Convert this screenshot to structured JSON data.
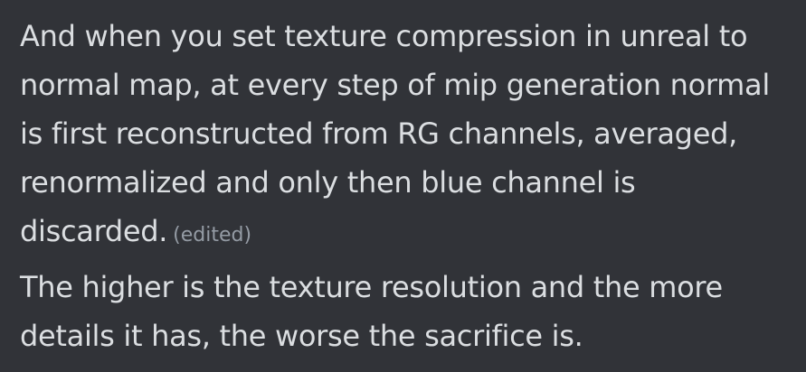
{
  "messages": [
    {
      "lines": [
        "And when you set texture compression in unreal to",
        "normal map, at every step of mip generation normal",
        "is first reconstructed from RG channels, averaged,",
        "renormalized and only then blue channel is",
        "discarded."
      ],
      "edited_label": "(edited)"
    },
    {
      "lines": [
        "The higher is the texture resolution and the more",
        "details it has, the worse the sacrifice is."
      ]
    }
  ],
  "colors": {
    "background": "#313338",
    "message_text": "#dbdee1",
    "edited_text": "#949ba4"
  }
}
